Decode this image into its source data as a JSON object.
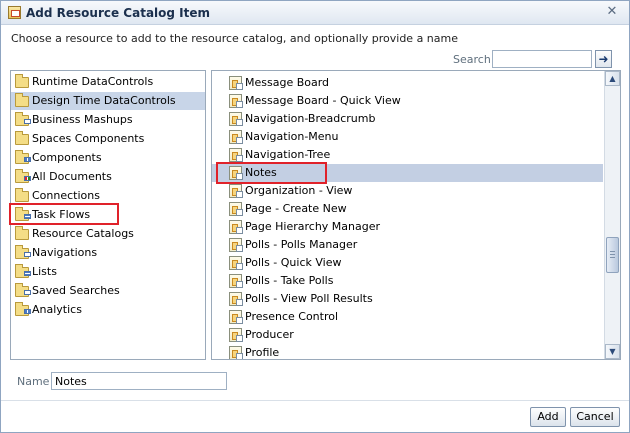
{
  "dialog": {
    "title": "Add Resource Catalog Item",
    "instructions": "Choose a resource to add to the resource catalog, and optionally provide a name"
  },
  "search": {
    "label": "Search",
    "value": "",
    "go_icon": "arrow-right-icon"
  },
  "left_list": {
    "items": [
      {
        "label": "Runtime DataControls",
        "icon": "folder-icon"
      },
      {
        "label": "Design Time DataControls",
        "icon": "folder-icon",
        "selected": true
      },
      {
        "label": "Business Mashups",
        "icon": "mashup-folder-icon"
      },
      {
        "label": "Spaces Components",
        "icon": "folder-icon"
      },
      {
        "label": "Components",
        "icon": "grid-folder-icon"
      },
      {
        "label": "All Documents",
        "icon": "chart-folder-icon"
      },
      {
        "label": "Connections",
        "icon": "folder-icon"
      },
      {
        "label": "Task Flows",
        "icon": "taskflow-folder-icon",
        "highlighted": true
      },
      {
        "label": "Resource Catalogs",
        "icon": "folder-icon"
      },
      {
        "label": "Navigations",
        "icon": "navigation-folder-icon"
      },
      {
        "label": "Lists",
        "icon": "list-folder-icon"
      },
      {
        "label": "Saved Searches",
        "icon": "search-folder-icon"
      },
      {
        "label": "Analytics",
        "icon": "analytics-folder-icon"
      }
    ]
  },
  "right_list": {
    "items": [
      {
        "label": "Message Board"
      },
      {
        "label": "Message Board - Quick View"
      },
      {
        "label": "Navigation-Breadcrumb"
      },
      {
        "label": "Navigation-Menu"
      },
      {
        "label": "Navigation-Tree"
      },
      {
        "label": "Notes",
        "selected": true,
        "highlighted": true
      },
      {
        "label": "Organization - View"
      },
      {
        "label": "Page - Create New"
      },
      {
        "label": "Page Hierarchy Manager"
      },
      {
        "label": "Polls - Polls Manager"
      },
      {
        "label": "Polls - Quick View"
      },
      {
        "label": "Polls - Take Polls"
      },
      {
        "label": "Polls - View Poll Results"
      },
      {
        "label": "Presence Control"
      },
      {
        "label": "Producer"
      },
      {
        "label": "Profile"
      }
    ]
  },
  "name_field": {
    "label": "Name",
    "value": "Notes"
  },
  "buttons": {
    "add": "Add",
    "cancel": "Cancel"
  },
  "colors": {
    "selection": "#c3cfe3",
    "highlight_box": "#e0222a"
  }
}
